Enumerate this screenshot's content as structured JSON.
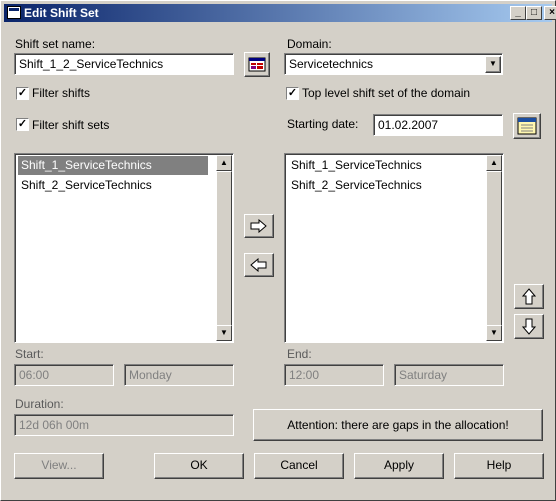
{
  "window": {
    "title": "Edit Shift Set",
    "minimize": "_",
    "maximize": "□",
    "close": "×"
  },
  "shift_set": {
    "label": "Shift set name:",
    "value": "Shift_1_2_ServiceTechnics"
  },
  "domain": {
    "label": "Domain:",
    "value": "Servicetechnics"
  },
  "filters": {
    "filter_shifts": {
      "label": "Filter shifts",
      "checked": true
    },
    "filter_shift_sets": {
      "label": "Filter shift sets",
      "checked": true
    },
    "top_level": {
      "label": "Top level shift set of the domain",
      "checked": true
    }
  },
  "starting_date": {
    "label": "Starting date:",
    "value": "01.02.2007"
  },
  "left_list": {
    "items": [
      "Shift_1_ServiceTechnics",
      "Shift_2_ServiceTechnics"
    ],
    "selected_index": 0
  },
  "right_list": {
    "items": [
      "Shift_1_ServiceTechnics",
      "Shift_2_ServiceTechnics"
    ]
  },
  "start": {
    "label": "Start:",
    "time": "06:00",
    "day": "Monday"
  },
  "end": {
    "label": "End:",
    "time": "12:00",
    "day": "Saturday"
  },
  "duration": {
    "label": "Duration:",
    "value": "12d 06h 00m"
  },
  "attention": "Attention: there are gaps in the allocation!",
  "buttons": {
    "view": "View...",
    "ok": "OK",
    "cancel": "Cancel",
    "apply": "Apply",
    "help": "Help"
  },
  "icons": {
    "shift_set_picker": "shift-set-picker-icon",
    "calendar": "calendar-icon",
    "add": "arrow-right-icon",
    "remove": "arrow-left-icon",
    "up": "arrow-up-icon",
    "down": "arrow-down-icon"
  }
}
